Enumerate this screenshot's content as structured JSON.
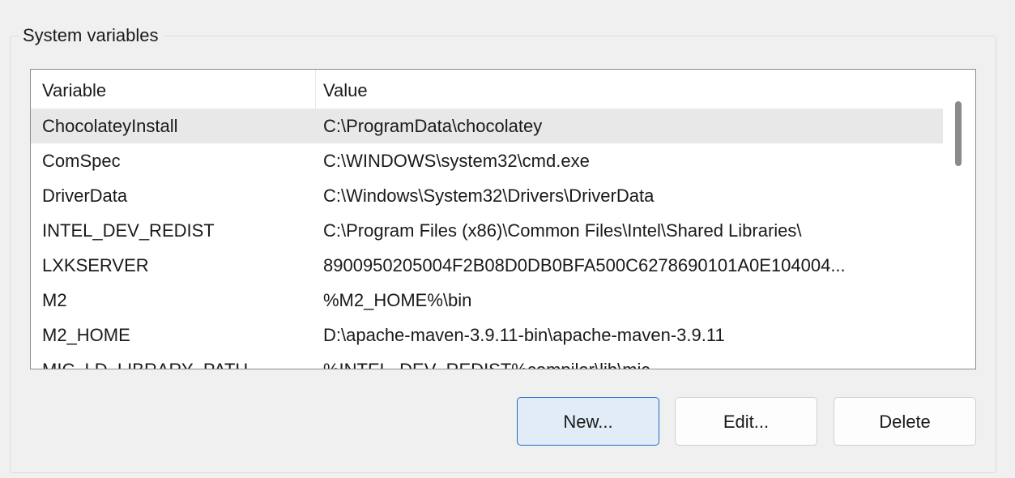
{
  "group": {
    "title": "System variables"
  },
  "table": {
    "columns": {
      "variable": "Variable",
      "value": "Value"
    },
    "rows": [
      {
        "variable": "ChocolateyInstall",
        "value": "C:\\ProgramData\\chocolatey"
      },
      {
        "variable": "ComSpec",
        "value": "C:\\WINDOWS\\system32\\cmd.exe"
      },
      {
        "variable": "DriverData",
        "value": "C:\\Windows\\System32\\Drivers\\DriverData"
      },
      {
        "variable": "INTEL_DEV_REDIST",
        "value": "C:\\Program Files (x86)\\Common Files\\Intel\\Shared Libraries\\"
      },
      {
        "variable": "LXKSERVER",
        "value": "8900950205004F2B08D0DB0BFA500C6278690101A0E104004..."
      },
      {
        "variable": "M2",
        "value": "%M2_HOME%\\bin"
      },
      {
        "variable": "M2_HOME",
        "value": "D:\\apache-maven-3.9.11-bin\\apache-maven-3.9.11"
      },
      {
        "variable": "MIC_LD_LIBRARY_PATH",
        "value": "%INTEL_DEV_REDIST%compiler\\lib\\mic"
      }
    ],
    "selected_row": 0
  },
  "buttons": {
    "new": "New...",
    "edit": "Edit...",
    "delete": "Delete"
  }
}
